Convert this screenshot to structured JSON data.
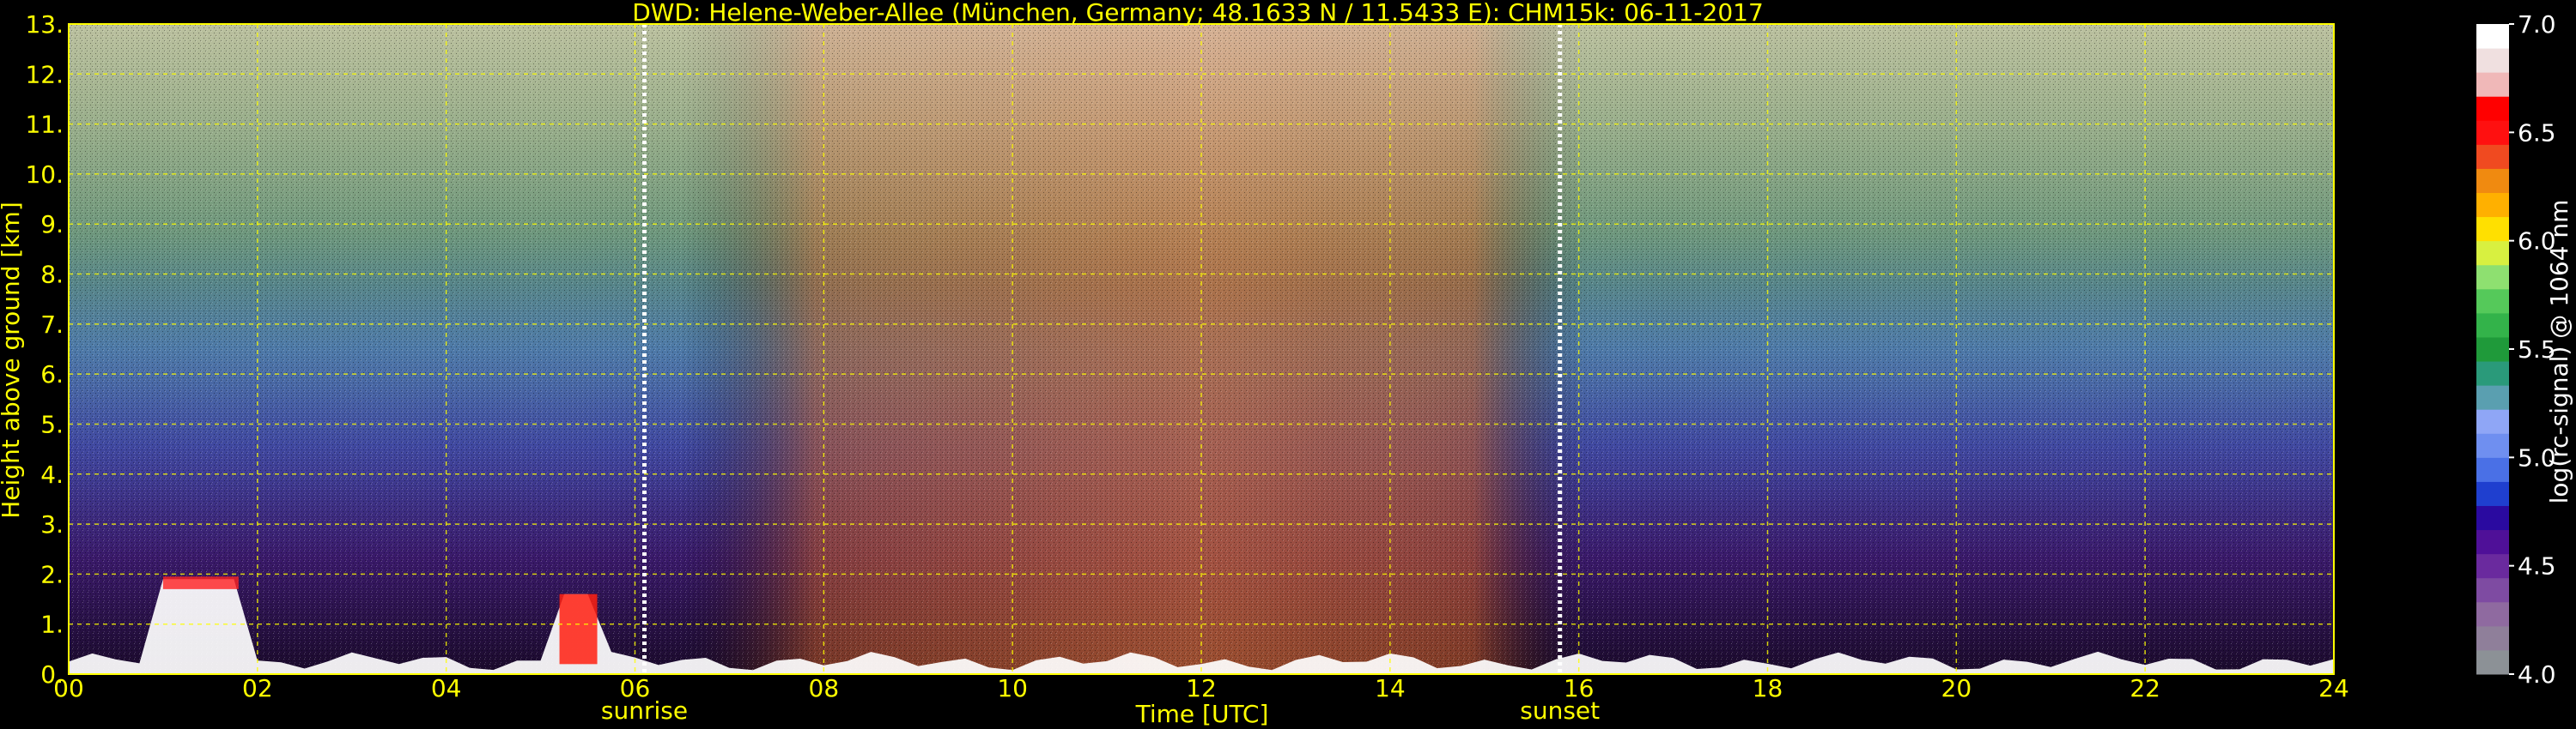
{
  "chart_data": {
    "type": "heatmap",
    "title": "DWD: Helene-Weber-Allee (München, Germany; 48.1633 N / 11.5433 E):    CHM15k: 06-11-2017",
    "xlabel": "Time [UTC]",
    "ylabel": "Height above ground [km]",
    "colorbar_label": "log(rc-signal) @ 1064 nm",
    "xlim": [
      0,
      24
    ],
    "ylim": [
      0,
      13
    ],
    "x_ticks": [
      0,
      2,
      4,
      6,
      8,
      10,
      12,
      14,
      16,
      18,
      20,
      22,
      24
    ],
    "x_tick_labels": [
      "00",
      "02",
      "04",
      "06",
      "08",
      "10",
      "12",
      "14",
      "16",
      "18",
      "20",
      "22",
      "24"
    ],
    "y_ticks": [
      0,
      1,
      2,
      3,
      4,
      5,
      6,
      7,
      8,
      9,
      10,
      11,
      12,
      13
    ],
    "y_tick_labels": [
      "0.",
      "1.",
      "2.",
      "3.",
      "4.",
      "5.",
      "6.",
      "7.",
      "8.",
      "9.",
      "10.",
      "11.",
      "12.",
      "13."
    ],
    "colorbar_range": [
      4.0,
      7.0
    ],
    "colorbar_ticks": [
      4.0,
      4.5,
      5.0,
      5.5,
      6.0,
      6.5,
      7.0
    ],
    "colorbar_tick_labels": [
      "4.0",
      "4.5",
      "5.0",
      "5.5",
      "6.0",
      "6.5",
      "7.0"
    ],
    "colorscale": [
      "#8c9196",
      "#8f7f9a",
      "#8f6aa0",
      "#7e4ba2",
      "#6a2a9e",
      "#4f1098",
      "#2a0aa0",
      "#1f3fcf",
      "#4a70e6",
      "#6f8ff0",
      "#8fa6f6",
      "#5a9fb0",
      "#2a9a7a",
      "#1f9a3a",
      "#33b34a",
      "#55c95a",
      "#8ee070",
      "#d8f040",
      "#ffe000",
      "#ffb000",
      "#f08a10",
      "#f04a20",
      "#ff1010",
      "#ff0000",
      "#f0b8b8",
      "#f0e0e0",
      "#ffffff"
    ],
    "grid": true,
    "grid_color": "#ffff00",
    "axis_color": "#ffff00",
    "background": "#000000",
    "markers": [
      {
        "label": "sunrise",
        "x": 6.1
      },
      {
        "label": "sunset",
        "x": 15.8
      }
    ]
  }
}
